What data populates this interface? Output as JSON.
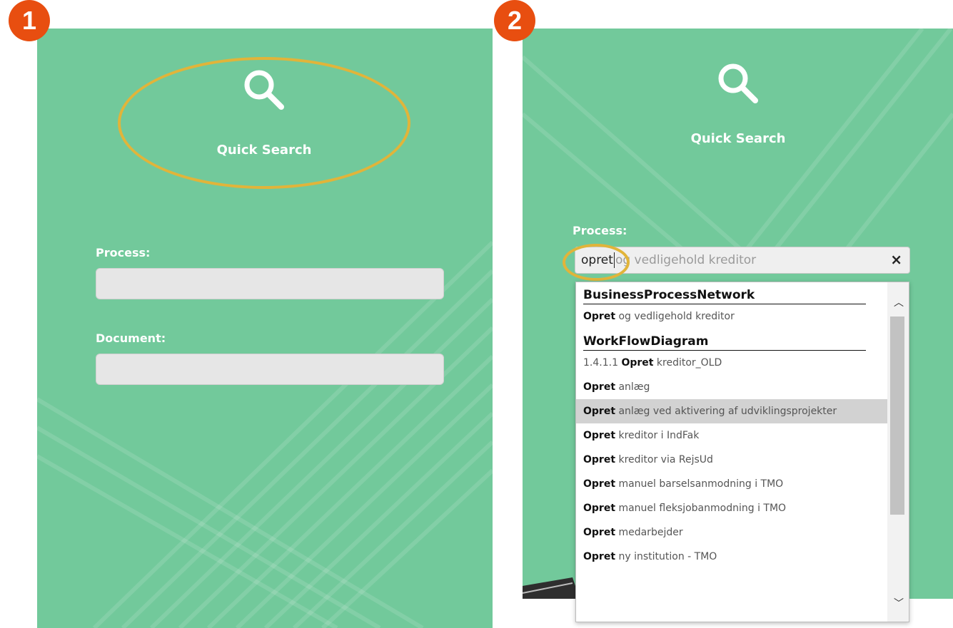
{
  "steps": {
    "first": "1",
    "second": "2"
  },
  "panel1": {
    "quick_search": "Quick Search",
    "process_label": "Process:",
    "document_label": "Document:"
  },
  "panel2": {
    "quick_search": "Quick Search",
    "process_label": "Process:",
    "input_typed": "opret",
    "input_suggestion": "og vedligehold kreditor",
    "clear_symbol": "×",
    "dropdown": {
      "groups": [
        {
          "name": "BusinessProcessNetwork",
          "items": [
            {
              "prefix": "",
              "bold": "Opret",
              "rest": " og vedligehold kreditor"
            }
          ]
        },
        {
          "name": "WorkFlowDiagram",
          "items": [
            {
              "prefix": "1.4.1.1 ",
              "bold": "Opret",
              "rest": " kreditor_OLD"
            },
            {
              "prefix": "",
              "bold": "Opret",
              "rest": " anlæg"
            },
            {
              "prefix": "",
              "bold": "Opret",
              "rest": " anlæg ved aktivering af udviklingsprojekter",
              "selected": true
            },
            {
              "prefix": "",
              "bold": "Opret",
              "rest": " kreditor i IndFak"
            },
            {
              "prefix": "",
              "bold": "Opret",
              "rest": " kreditor via RejsUd"
            },
            {
              "prefix": "",
              "bold": "Opret",
              "rest": " manuel barselsanmodning i TMO"
            },
            {
              "prefix": "",
              "bold": "Opret",
              "rest": " manuel fleksjobanmodning i TMO"
            },
            {
              "prefix": "",
              "bold": "Opret",
              "rest": " medarbejder"
            },
            {
              "prefix": "",
              "bold": "Opret",
              "rest": " ny institution - TMO"
            }
          ]
        }
      ]
    }
  },
  "icons": {
    "search": "search-icon",
    "scroll_up": "chevron-up-icon",
    "scroll_down": "chevron-down-icon"
  },
  "colors": {
    "panel_green": "#72c99b",
    "badge_orange": "#e84e10",
    "highlight_yellow": "#e1b43a",
    "selected_row": "#d2d2d2"
  }
}
